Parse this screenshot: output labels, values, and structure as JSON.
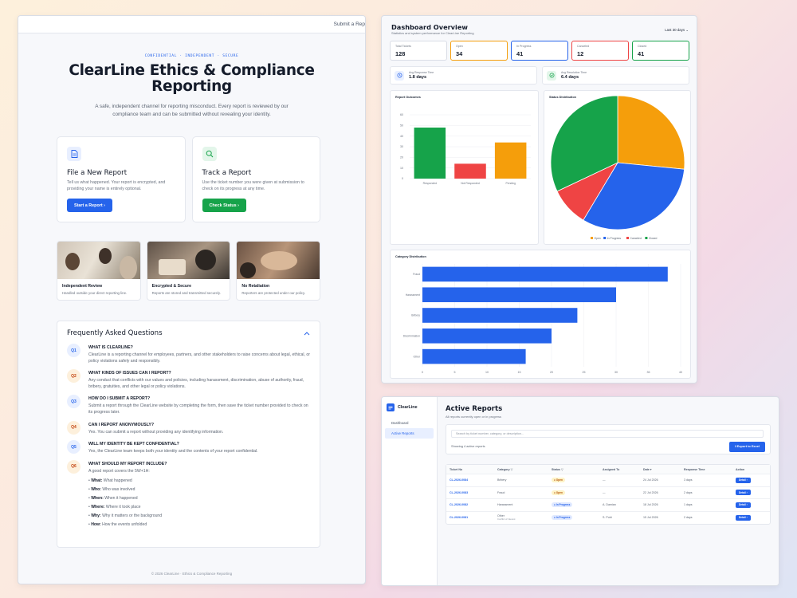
{
  "landing": {
    "top_link": "Submit a Rep",
    "eyebrow": "CONFIDENTIAL · INDEPENDENT · SECURE",
    "title_line1": "ClearLine Ethics & Compliance",
    "title_line2": "Reporting",
    "subtitle": "A safe, independent channel for reporting misconduct. Every report is reviewed by our compliance team and can be submitted without revealing your identity.",
    "cards": [
      {
        "icon": "document-icon",
        "title": "File a New Report",
        "text": "Tell us what happened. Your report is encrypted, and providing your name is entirely optional.",
        "button": "Start a Report ›"
      },
      {
        "icon": "search-icon",
        "title": "Track a Report",
        "text": "Use the ticket number you were given at submission to check on its progress at any time.",
        "button": "Check Status ›"
      }
    ],
    "features": [
      {
        "title": "Independent Review",
        "text": "Handled outside your direct reporting line."
      },
      {
        "title": "Encrypted & Secure",
        "text": "Reports are stored and transmitted securely."
      },
      {
        "title": "No Retaliation",
        "text": "Reporters are protected under our policy."
      }
    ],
    "faq_title": "Frequently Asked Questions",
    "faq": [
      {
        "num": "Q1",
        "q": "WHAT IS CLEARLINE?",
        "a": "ClearLine is a reporting channel for employees, partners, and other stakeholders to raise concerns about legal, ethical, or policy violations safely and responsibly."
      },
      {
        "num": "Q2",
        "q": "WHAT KINDS OF ISSUES CAN I REPORT?",
        "a": "Any conduct that conflicts with our values and policies, including harassment, discrimination, abuse of authority, fraud, bribery, gratuities, and other legal or policy violations."
      },
      {
        "num": "Q3",
        "q": "HOW DO I SUBMIT A REPORT?",
        "a": "Submit a report through the ClearLine website by completing the form, then save the ticket number provided to check on its progress later."
      },
      {
        "num": "Q4",
        "q": "CAN I REPORT ANONYMOUSLY?",
        "a": "Yes. You can submit a report without providing any identifying information."
      },
      {
        "num": "Q5",
        "q": "WILL MY IDENTITY BE KEPT CONFIDENTIAL?",
        "a": "Yes, the ClearLine team keeps both your identity and the contents of your report confidential."
      },
      {
        "num": "Q6",
        "q": "WHAT SHOULD MY REPORT INCLUDE?",
        "a": "A good report covers the 5W+1H:"
      }
    ],
    "faq_list": [
      {
        "k": "What:",
        "v": "What happened"
      },
      {
        "k": "Who:",
        "v": "Who was involved"
      },
      {
        "k": "When:",
        "v": "When it happened"
      },
      {
        "k": "Where:",
        "v": "Where it took place"
      },
      {
        "k": "Why:",
        "v": "Why it matters or the background"
      },
      {
        "k": "How:",
        "v": "How the events unfolded"
      }
    ],
    "footer": "© 2026 ClearLine · Ethics & Compliance Reporting"
  },
  "dashboard": {
    "title": "Dashboard Overview",
    "subtitle": "Statistics and system performance for ClearLine Reporting",
    "range": "Last 30 days ⌄",
    "stats": [
      {
        "label": "Total Tickets",
        "value": "128",
        "color": "#d9dde6"
      },
      {
        "label": "Open",
        "value": "34",
        "color": "#f59e0b"
      },
      {
        "label": "In Progress",
        "value": "41",
        "color": "#2563eb"
      },
      {
        "label": "Canceled",
        "value": "12",
        "color": "#ef4444"
      },
      {
        "label": "Closed",
        "value": "41",
        "color": "#16a34a"
      }
    ],
    "metrics": [
      {
        "label": "Avg Response Time",
        "value": "1.8 days",
        "icon": "clock-icon"
      },
      {
        "label": "Avg Resolution Time",
        "value": "6.4 days",
        "icon": "check-icon"
      }
    ],
    "outcomes_title": "Report Outcomes",
    "status_title": "Status Distribution",
    "category_title": "Category Distribution"
  },
  "chart_data": [
    {
      "type": "bar",
      "title": "Report Outcomes",
      "categories": [
        "Responded",
        "Not Responded",
        "Pending"
      ],
      "values": [
        48,
        14,
        34
      ],
      "colors": [
        "#16a34a",
        "#ef4444",
        "#f59e0b"
      ],
      "ylim": [
        0,
        60
      ],
      "yticks": [
        0,
        10,
        20,
        30,
        40,
        50,
        60
      ]
    },
    {
      "type": "pie",
      "title": "Status Distribution",
      "labels": [
        "Open",
        "In Progress",
        "Canceled",
        "Closed"
      ],
      "values": [
        34,
        41,
        12,
        41
      ],
      "colors": [
        "#f59e0b",
        "#2563eb",
        "#ef4444",
        "#16a34a"
      ],
      "legend": "bottom"
    },
    {
      "type": "bar",
      "orientation": "horizontal",
      "title": "Category Distribution",
      "categories": [
        "Fraud",
        "Harassment",
        "Bribery",
        "Discrimination",
        "Other"
      ],
      "values": [
        38,
        30,
        24,
        20,
        16
      ],
      "color": "#2563eb",
      "xlim": [
        0,
        40
      ],
      "xticks": [
        0,
        5,
        10,
        15,
        20,
        25,
        30,
        35,
        40
      ]
    }
  ],
  "reports": {
    "brand": "ClearLine",
    "nav": [
      "Dashboard",
      "Active Reports"
    ],
    "title": "Active Reports",
    "subtitle": "All reports currently open or in progress",
    "search_placeholder": "Search by ticket number, category, or description...",
    "showing": "Showing 4 active reports",
    "export": "⭳ Export to Excel",
    "columns": [
      "Ticket No",
      "Category ▽",
      "Status ▽",
      "Assigned To",
      "Date ▾",
      "Response Time",
      "Action"
    ],
    "rows": [
      {
        "ticket": "CL-2026-0084",
        "category": "Bribery",
        "sub": "",
        "status": "● Open",
        "kind": "open",
        "assigned": "—",
        "date": "24 Jul 2026",
        "resp": "3 days",
        "action": "Detail ›"
      },
      {
        "ticket": "CL-2026-0083",
        "category": "Fraud",
        "sub": "",
        "status": "● Open",
        "kind": "open",
        "assigned": "—",
        "date": "22 Jul 2026",
        "resp": "2 days",
        "action": "Detail ›"
      },
      {
        "ticket": "CL-2026-0082",
        "category": "Harassment",
        "sub": "",
        "status": "● In Progress",
        "kind": "prog",
        "assigned": "A. Damian",
        "date": "18 Jul 2026",
        "resp": "1 days",
        "action": "Detail ›"
      },
      {
        "ticket": "CL-2026-0081",
        "category": "Other",
        "sub": "Conflict of interest",
        "status": "● In Progress",
        "kind": "prog",
        "assigned": "S. Putri",
        "date": "15 Jul 2026",
        "resp": "2 days",
        "action": "Detail ›"
      }
    ]
  }
}
